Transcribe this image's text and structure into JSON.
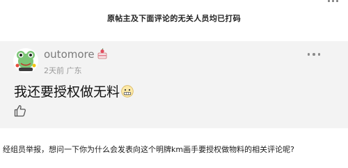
{
  "notice": "原帖主及下面评论的无关人员均已打码",
  "comment_card": {
    "username": "outomore",
    "time": "2天前",
    "location": "广东",
    "text": "我还要授权做无料"
  },
  "question": "经组员举报，想问一下你为什么会发表向这个明牌km画手要授权做物料的相关评论呢?",
  "colors": {
    "card_background": "#f3f3f3",
    "username": "#7a7a7a",
    "meta": "#9a9a9a",
    "avatar_green": "#7cc576"
  },
  "icons": {
    "avatar": "frog-avatar-icon",
    "badge": "cake-badge-icon",
    "emoji": "grimace-emoji-icon",
    "more": "more-dots-icon",
    "like": "thumbs-up-icon"
  }
}
